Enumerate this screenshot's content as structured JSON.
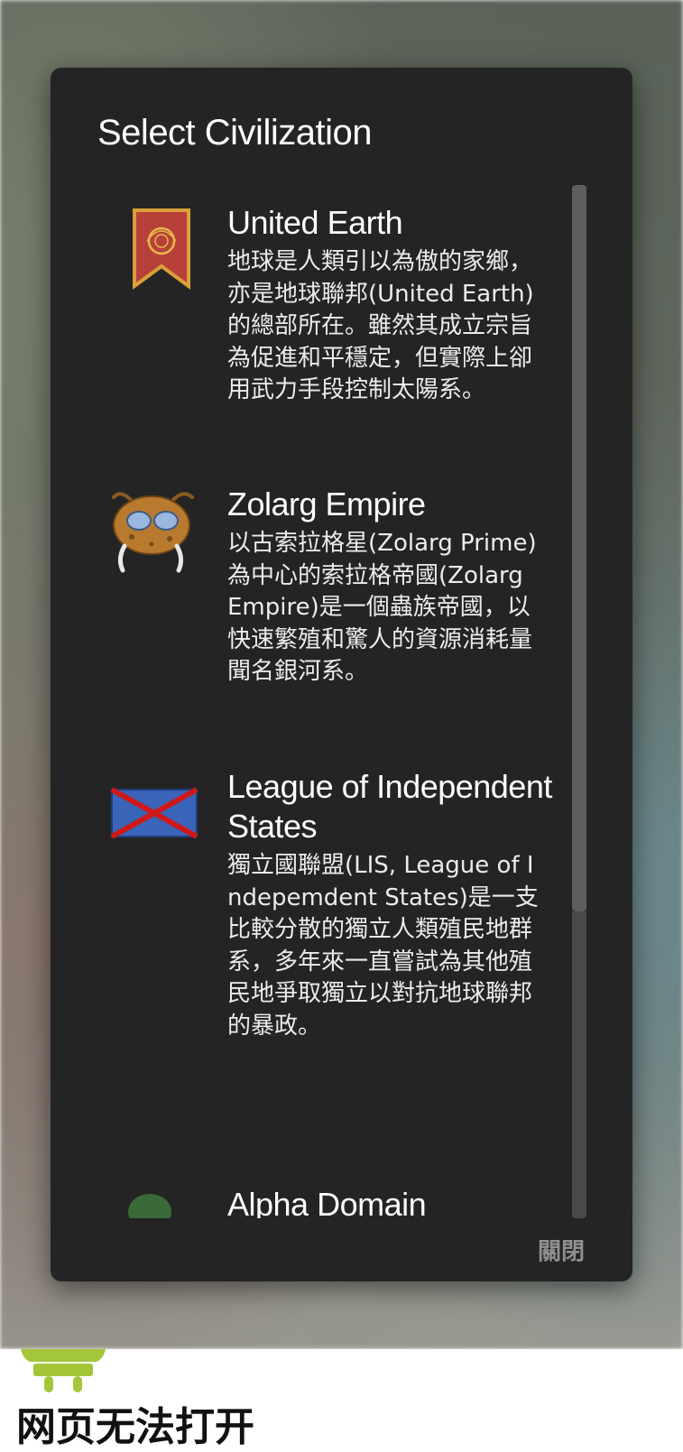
{
  "dialog": {
    "title": "Select Civilization",
    "close_label": "關閉",
    "civilizations": [
      {
        "name": "United Earth",
        "icon": "banner-icon",
        "description": "地球是人類引以為傲的家鄉，亦是地球聯邦(United Earth)的總部所在。雖然其成立宗旨為促進和平穩定，但實際上卻用武力手段控制太陽系。"
      },
      {
        "name": "Zolarg Empire",
        "icon": "insect-head-icon",
        "description": "以古索拉格星(Zolarg Prime)為中心的索拉格帝國(Zolarg Empire)是一個蟲族帝國，以快速繁殖和驚人的資源消耗量聞名銀河系。"
      },
      {
        "name": "League of Independent States",
        "icon": "saltire-flag-icon",
        "description": "獨立國聯盟(LIS, League of Indepemdent States)是一支比較分散的獨立人類殖民地群系，多年來一直嘗試為其他殖民地爭取獨立以對抗地球聯邦的暴政。"
      },
      {
        "name": "Alpha Domain",
        "icon": "partial-emblem-icon",
        "description": ""
      }
    ]
  },
  "error_page": {
    "title": "网页无法打开",
    "icon": "android-icon"
  },
  "colors": {
    "dialog_bg": "#242424",
    "close_text": "#8f8f8f",
    "flag_blue": "#3a64b8",
    "flag_red": "#d01818",
    "banner_red": "#b8403a",
    "banner_gold": "#d9a03a"
  }
}
